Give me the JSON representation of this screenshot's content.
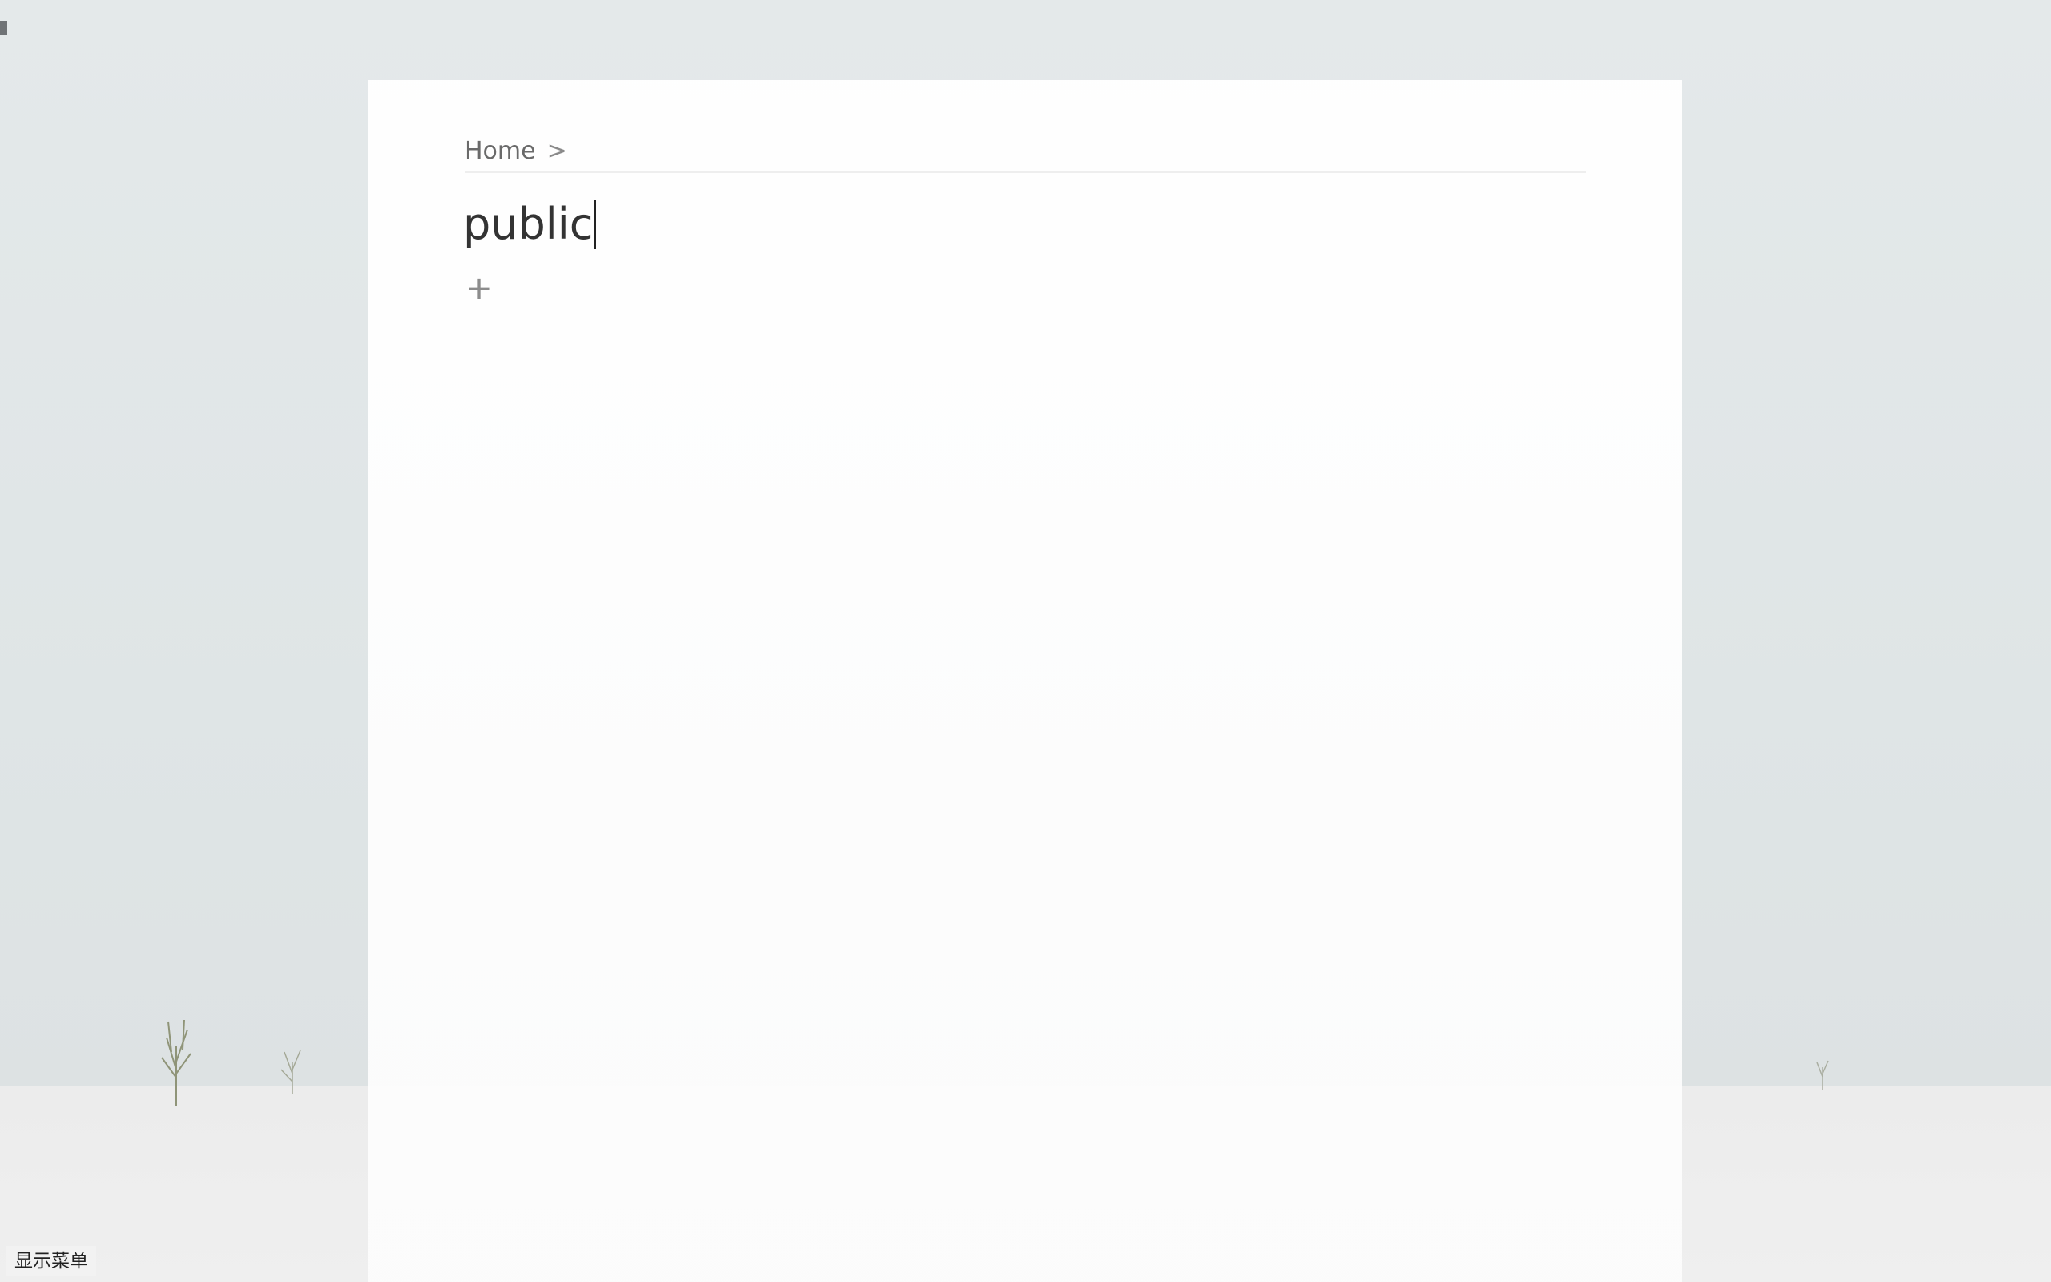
{
  "breadcrumb": {
    "home_label": "Home",
    "separator": ">"
  },
  "page": {
    "title": "public",
    "add_label": "+"
  },
  "menu": {
    "show_menu_label": "显示菜单"
  },
  "background": {
    "sky_color": "#e1e6e7",
    "snow_color": "#eeeeee"
  }
}
